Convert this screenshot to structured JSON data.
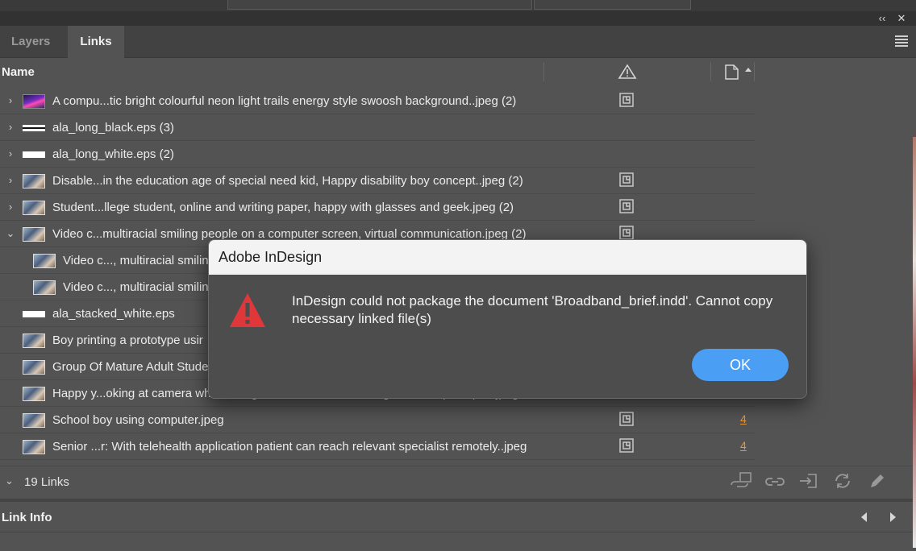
{
  "tabs": [
    {
      "label": "Layers",
      "active": false
    },
    {
      "label": "Links",
      "active": true
    }
  ],
  "columns": {
    "name": "Name",
    "status_icon": "warning-triangle-icon",
    "page_icon": "page-sort-icon"
  },
  "rows": [
    {
      "label": "A compu...tic bright colourful neon light trails energy style swoosh background..jpeg (2)",
      "expander": "collapsed",
      "thumb": "neon",
      "status": "embedded-icon",
      "page": ""
    },
    {
      "label": "ala_long_black.eps (3)",
      "expander": "collapsed",
      "thumb": "eps-black",
      "status": "",
      "page": ""
    },
    {
      "label": "ala_long_white.eps (2)",
      "expander": "collapsed",
      "thumb": "eps-white",
      "status": "",
      "page": ""
    },
    {
      "label": "Disable...in the education age of special need kid, Happy disability boy concept..jpeg (2)",
      "expander": "collapsed",
      "thumb": "photo",
      "status": "embedded-icon",
      "page": ""
    },
    {
      "label": "Student...llege student, online and writing paper, happy with glasses and geek.jpeg (2)",
      "expander": "collapsed",
      "thumb": "photo",
      "status": "embedded-icon",
      "page": ""
    },
    {
      "label": "Video c...multiracial smiling people on a computer screen, virtual communication.jpeg (2)",
      "expander": "expanded",
      "thumb": "photo",
      "status": "embedded-icon",
      "page": ""
    },
    {
      "label": "Video c..., multiracial smilin",
      "expander": "child",
      "thumb": "photo",
      "status": "",
      "page": ""
    },
    {
      "label": "Video c..., multiracial smilin",
      "expander": "child",
      "thumb": "photo",
      "status": "",
      "page": ""
    },
    {
      "label": "ala_stacked_white.eps",
      "expander": "none",
      "thumb": "eps-white",
      "status": "",
      "page": ""
    },
    {
      "label": "Boy printing a prototype usir",
      "expander": "none",
      "thumb": "photo",
      "status": "",
      "page": ""
    },
    {
      "label": "Group Of Mature Adult Stude",
      "expander": "none",
      "thumb": "photo",
      "status": "",
      "page": ""
    },
    {
      "label": "Happy y...oking at camera while sitting at the table and working on tablet.pc, ?.pdd.jpeg",
      "expander": "none",
      "thumb": "photo",
      "status": "",
      "page": ""
    },
    {
      "label": "School boy using computer.jpeg",
      "expander": "none",
      "thumb": "photo",
      "status": "embedded-icon",
      "page": "4"
    },
    {
      "label": "Senior ...r: With telehealth application patient can reach relevant specialist remotely..jpeg",
      "expander": "none",
      "thumb": "photo",
      "status": "embedded-icon",
      "page": "4"
    }
  ],
  "footer": {
    "count": "19 Links",
    "tools": [
      "relink-cc-icon",
      "relink-icon",
      "go-to-link-icon",
      "update-link-icon",
      "edit-original-icon"
    ]
  },
  "link_info": {
    "title": "Link Info"
  },
  "dialog": {
    "title": "Adobe InDesign",
    "message": "InDesign could not package the document 'Broadband_brief.indd'. Cannot copy necessary linked file(s)",
    "ok_label": "OK",
    "icon": "alert-triangle-icon",
    "accent": "#4a9ff5",
    "alert_color": "#e0383a"
  },
  "colors": {
    "panel_bg": "#535353",
    "page_link": "#e8963a"
  }
}
